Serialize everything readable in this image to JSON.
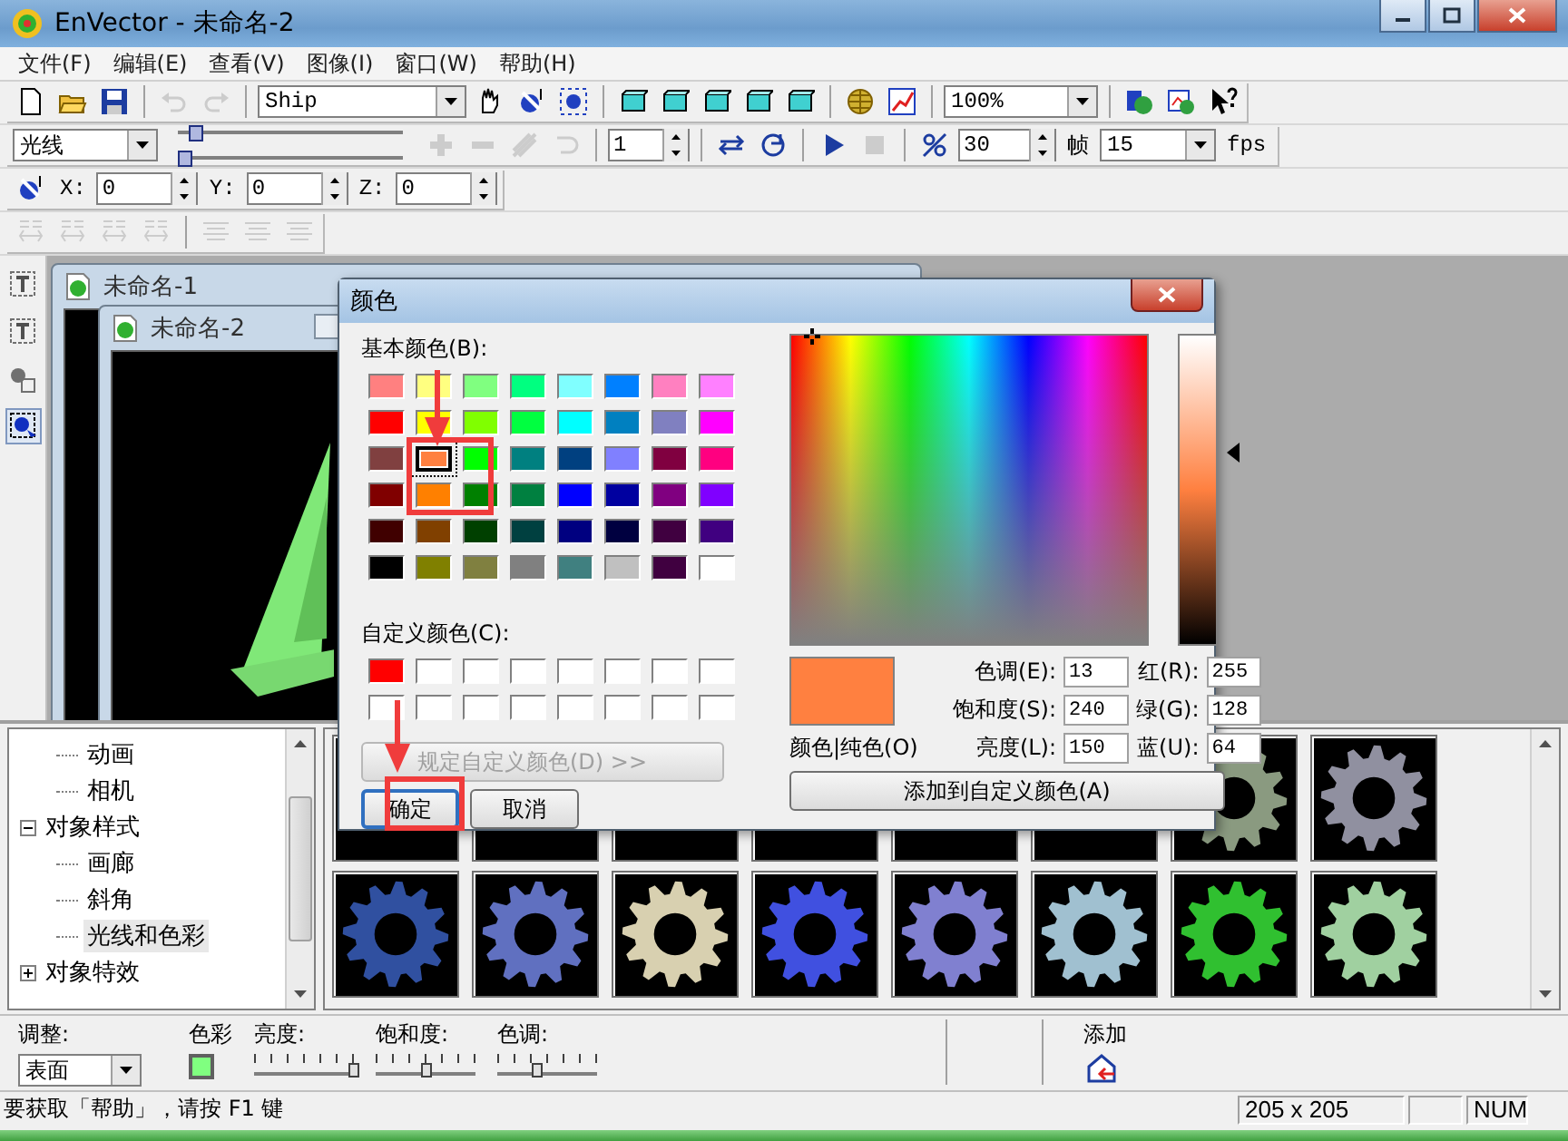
{
  "window": {
    "title": "EnVector - 未命名-2"
  },
  "menu": [
    "文件(F)",
    "编辑(E)",
    "查看(V)",
    "图像(I)",
    "窗口(W)",
    "帮助(H)"
  ],
  "toolbars": [
    [
      {
        "kind": "new",
        "disabled": false
      },
      {
        "kind": "open",
        "disabled": false
      },
      {
        "kind": "save",
        "disabled": false
      },
      {
        "kind": "sep"
      },
      {
        "kind": "undo",
        "disabled": true
      },
      {
        "kind": "redo",
        "disabled": true
      },
      {
        "kind": "sep"
      },
      {
        "kind": "combo",
        "value": "Ship"
      },
      {
        "kind": "hand",
        "disabled": false
      },
      {
        "kind": "rotate",
        "disabled": false
      },
      {
        "kind": "target",
        "disabled": false
      },
      {
        "kind": "sep"
      },
      {
        "kind": "box",
        "disabled": false
      },
      {
        "kind": "box",
        "disabled": false
      },
      {
        "kind": "box",
        "disabled": false
      },
      {
        "kind": "box",
        "disabled": false
      },
      {
        "kind": "box",
        "disabled": false
      },
      {
        "kind": "sep"
      },
      {
        "kind": "globe",
        "disabled": false
      },
      {
        "kind": "chart",
        "disabled": false
      },
      {
        "kind": "sep"
      },
      {
        "kind": "combo",
        "value": "100%"
      },
      {
        "kind": "sep"
      },
      {
        "kind": "earthpic",
        "disabled": false
      },
      {
        "kind": "picture",
        "disabled": false
      },
      {
        "kind": "help",
        "disabled": false
      }
    ],
    [
      {
        "kind": "combo",
        "value": "光线"
      },
      {
        "kind": "sliders",
        "sliders": [
          {
            "level": 0.05
          },
          {
            "level": 0.0
          }
        ]
      },
      {
        "kind": "plus",
        "disabled": true
      },
      {
        "kind": "minus",
        "disabled": true
      },
      {
        "kind": "skew",
        "disabled": true
      },
      {
        "kind": "curve",
        "disabled": true
      },
      {
        "kind": "sep"
      },
      {
        "kind": "spin",
        "value": "1"
      },
      {
        "kind": "sep"
      },
      {
        "kind": "loop",
        "disabled": false
      },
      {
        "kind": "orbit",
        "disabled": false
      },
      {
        "kind": "sep"
      },
      {
        "kind": "play",
        "disabled": false
      },
      {
        "kind": "stop",
        "disabled": true
      },
      {
        "kind": "sep"
      },
      {
        "kind": "percent",
        "disabled": false
      },
      {
        "kind": "spin",
        "value": "30"
      },
      {
        "kind": "label",
        "text": "帧"
      },
      {
        "kind": "combo",
        "value": "15"
      },
      {
        "kind": "label",
        "text": "fps"
      }
    ],
    [
      {
        "kind": "rotate",
        "disabled": false
      },
      {
        "kind": "label",
        "text": "X:"
      },
      {
        "kind": "spin",
        "value": "0"
      },
      {
        "kind": "label",
        "text": "Y:"
      },
      {
        "kind": "spin",
        "value": "0"
      },
      {
        "kind": "label",
        "text": "Z:"
      },
      {
        "kind": "spin",
        "value": "0"
      }
    ],
    [
      {
        "kind": "textgap",
        "disabled": true
      },
      {
        "kind": "textgap",
        "disabled": true
      },
      {
        "kind": "textgap",
        "disabled": true
      },
      {
        "kind": "textgap",
        "disabled": true
      },
      {
        "kind": "sep"
      },
      {
        "kind": "align",
        "disabled": true
      },
      {
        "kind": "align",
        "disabled": true
      },
      {
        "kind": "align",
        "disabled": true
      }
    ]
  ],
  "tools": [
    {
      "kind": "textframe",
      "selected": false
    },
    {
      "kind": "textframe",
      "selected": false
    },
    {
      "kind": "shape",
      "selected": false
    },
    {
      "kind": "select",
      "selected": true
    }
  ],
  "documents": [
    {
      "title": "未命名-1"
    },
    {
      "title": "未命名-2"
    }
  ],
  "tree": {
    "items": [
      {
        "children": [
          {
            "label": "动画",
            "selected": false
          },
          {
            "label": "相机",
            "selected": false
          }
        ]
      },
      {
        "label": "对象样式",
        "expanded": true,
        "selected": false,
        "children": [
          {
            "label": "画廊",
            "selected": false
          },
          {
            "label": "斜角",
            "selected": false
          },
          {
            "label": "光线和色彩",
            "selected": true
          }
        ]
      },
      {
        "label": "对象特效",
        "expanded": false,
        "selected": false
      }
    ]
  },
  "gallery": [
    {
      "kind": "hidden"
    },
    {
      "kind": "hidden"
    },
    {
      "kind": "hidden"
    },
    {
      "kind": "hidden"
    },
    {
      "kind": "hidden"
    },
    {
      "kind": "hidden"
    },
    {
      "kind": "gear",
      "color": "#8a9a80"
    },
    {
      "kind": "gear",
      "color": "#9090a0"
    },
    {
      "kind": "gear",
      "color": "#3050a0"
    },
    {
      "kind": "gear",
      "color": "#6070c0"
    },
    {
      "kind": "gear",
      "color": "#d8d0b0"
    },
    {
      "kind": "gear",
      "color": "#4050e0"
    },
    {
      "kind": "gear",
      "color": "#8080d0"
    },
    {
      "kind": "gear",
      "color": "#a0c0d0"
    },
    {
      "kind": "gear",
      "color": "#30c030"
    },
    {
      "kind": "gear",
      "color": "#a0d0a0"
    }
  ],
  "controls": {
    "adjust_label": "调整:",
    "adjust_value": "表面",
    "color_label": "色彩",
    "color": "#80ff80",
    "sliders": [
      {
        "label": "亮度:",
        "level": 1.0
      },
      {
        "label": "饱和度:",
        "level": 0.5
      },
      {
        "label": "色调:",
        "level": 0.4
      }
    ],
    "add_label": "添加"
  },
  "status_bar": {
    "text": "要获取「帮助」，请按 F1 键",
    "size": "205 x 205",
    "mode": "NUM"
  },
  "dialog": {
    "title": "颜色",
    "basic_label": "基本颜色(B):",
    "basic_colors": [
      {
        "color": "#ff8080",
        "selected": false
      },
      {
        "color": "#ffff80",
        "selected": false
      },
      {
        "color": "#80ff80",
        "selected": false
      },
      {
        "color": "#00ff80",
        "selected": false
      },
      {
        "color": "#80ffff",
        "selected": false
      },
      {
        "color": "#0080ff",
        "selected": false
      },
      {
        "color": "#ff80c0",
        "selected": false
      },
      {
        "color": "#ff80ff",
        "selected": false
      },
      {
        "color": "#ff0000",
        "selected": false
      },
      {
        "color": "#ffff00",
        "selected": false
      },
      {
        "color": "#80ff00",
        "selected": false
      },
      {
        "color": "#00ff40",
        "selected": false
      },
      {
        "color": "#00ffff",
        "selected": false
      },
      {
        "color": "#0080c0",
        "selected": false
      },
      {
        "color": "#8080c0",
        "selected": false
      },
      {
        "color": "#ff00ff",
        "selected": false
      },
      {
        "color": "#804040",
        "selected": false
      },
      {
        "color": "#ff8040",
        "selected": true
      },
      {
        "color": "#00ff00",
        "selected": false
      },
      {
        "color": "#008080",
        "selected": false
      },
      {
        "color": "#004080",
        "selected": false
      },
      {
        "color": "#8080ff",
        "selected": false
      },
      {
        "color": "#800040",
        "selected": false
      },
      {
        "color": "#ff0080",
        "selected": false
      },
      {
        "color": "#800000",
        "selected": false
      },
      {
        "color": "#ff8000",
        "selected": false
      },
      {
        "color": "#008000",
        "selected": false
      },
      {
        "color": "#008040",
        "selected": false
      },
      {
        "color": "#0000ff",
        "selected": false
      },
      {
        "color": "#0000a0",
        "selected": false
      },
      {
        "color": "#800080",
        "selected": false
      },
      {
        "color": "#8000ff",
        "selected": false
      },
      {
        "color": "#400000",
        "selected": false
      },
      {
        "color": "#804000",
        "selected": false
      },
      {
        "color": "#004000",
        "selected": false
      },
      {
        "color": "#004040",
        "selected": false
      },
      {
        "color": "#000080",
        "selected": false
      },
      {
        "color": "#000040",
        "selected": false
      },
      {
        "color": "#400040",
        "selected": false
      },
      {
        "color": "#400080",
        "selected": false
      },
      {
        "color": "#000000",
        "selected": false
      },
      {
        "color": "#808000",
        "selected": false
      },
      {
        "color": "#808040",
        "selected": false
      },
      {
        "color": "#808080",
        "selected": false
      },
      {
        "color": "#408080",
        "selected": false
      },
      {
        "color": "#c0c0c0",
        "selected": false
      },
      {
        "color": "#400040",
        "selected": false
      },
      {
        "color": "#ffffff",
        "selected": false
      }
    ],
    "custom_label": "自定义颜色(C):",
    "custom_colors": [
      {
        "color": "#ff0000"
      },
      {
        "color": "#ffffff"
      },
      {
        "color": "#ffffff"
      },
      {
        "color": "#ffffff"
      },
      {
        "color": "#ffffff"
      },
      {
        "color": "#ffffff"
      },
      {
        "color": "#ffffff"
      },
      {
        "color": "#ffffff"
      },
      {
        "color": "#ffffff"
      },
      {
        "color": "#ffffff"
      },
      {
        "color": "#ffffff"
      },
      {
        "color": "#ffffff"
      },
      {
        "color": "#ffffff"
      },
      {
        "color": "#ffffff"
      },
      {
        "color": "#ffffff"
      },
      {
        "color": "#ffffff"
      }
    ],
    "define_button": {
      "label": "规定自定义颜色(D) >>",
      "disabled": true
    },
    "ok": "确定",
    "cancel": "取消",
    "preview": {
      "color": "#ff8040",
      "label": "颜色|纯色(O)"
    },
    "fields": [
      {
        "label": "色调(E):",
        "value": "13"
      },
      {
        "label": "红(R):",
        "value": "255"
      },
      {
        "label": "饱和度(S):",
        "value": "240"
      },
      {
        "label": "绿(G):",
        "value": "128"
      },
      {
        "label": "亮度(L):",
        "value": "150"
      },
      {
        "label": "蓝(U):",
        "value": "64"
      }
    ],
    "add_button": "添加到自定义颜色(A)"
  }
}
